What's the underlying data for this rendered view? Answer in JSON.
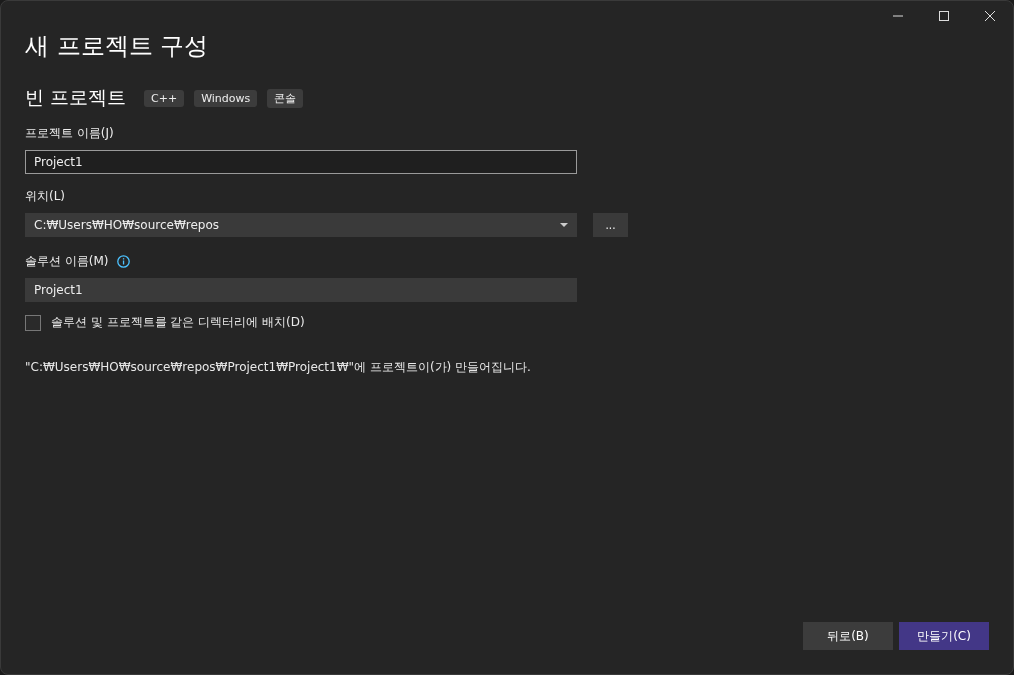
{
  "window": {
    "title": "새 프로젝트 구성"
  },
  "template": {
    "name": "빈 프로젝트",
    "tags": [
      "C++",
      "Windows",
      "콘솔"
    ]
  },
  "project_name": {
    "label": "프로젝트 이름(J)",
    "value": "Project1"
  },
  "location": {
    "label": "위치(L)",
    "value": "C:₩Users₩HO₩source₩repos",
    "browse": "..."
  },
  "solution_name": {
    "label": "솔루션 이름(M)",
    "value": "Project1"
  },
  "same_directory": {
    "label": "솔루션 및 프로젝트를 같은 디렉터리에 배치(D)",
    "checked": false
  },
  "summary": "\"C:₩Users₩HO₩source₩repos₩Project1₩Project1₩\"에 프로젝트이(가) 만들어집니다.",
  "buttons": [
    {
      "label": "뒤로(B)",
      "kind": "secondary"
    },
    {
      "label": "만들기(C)",
      "kind": "primary"
    }
  ]
}
